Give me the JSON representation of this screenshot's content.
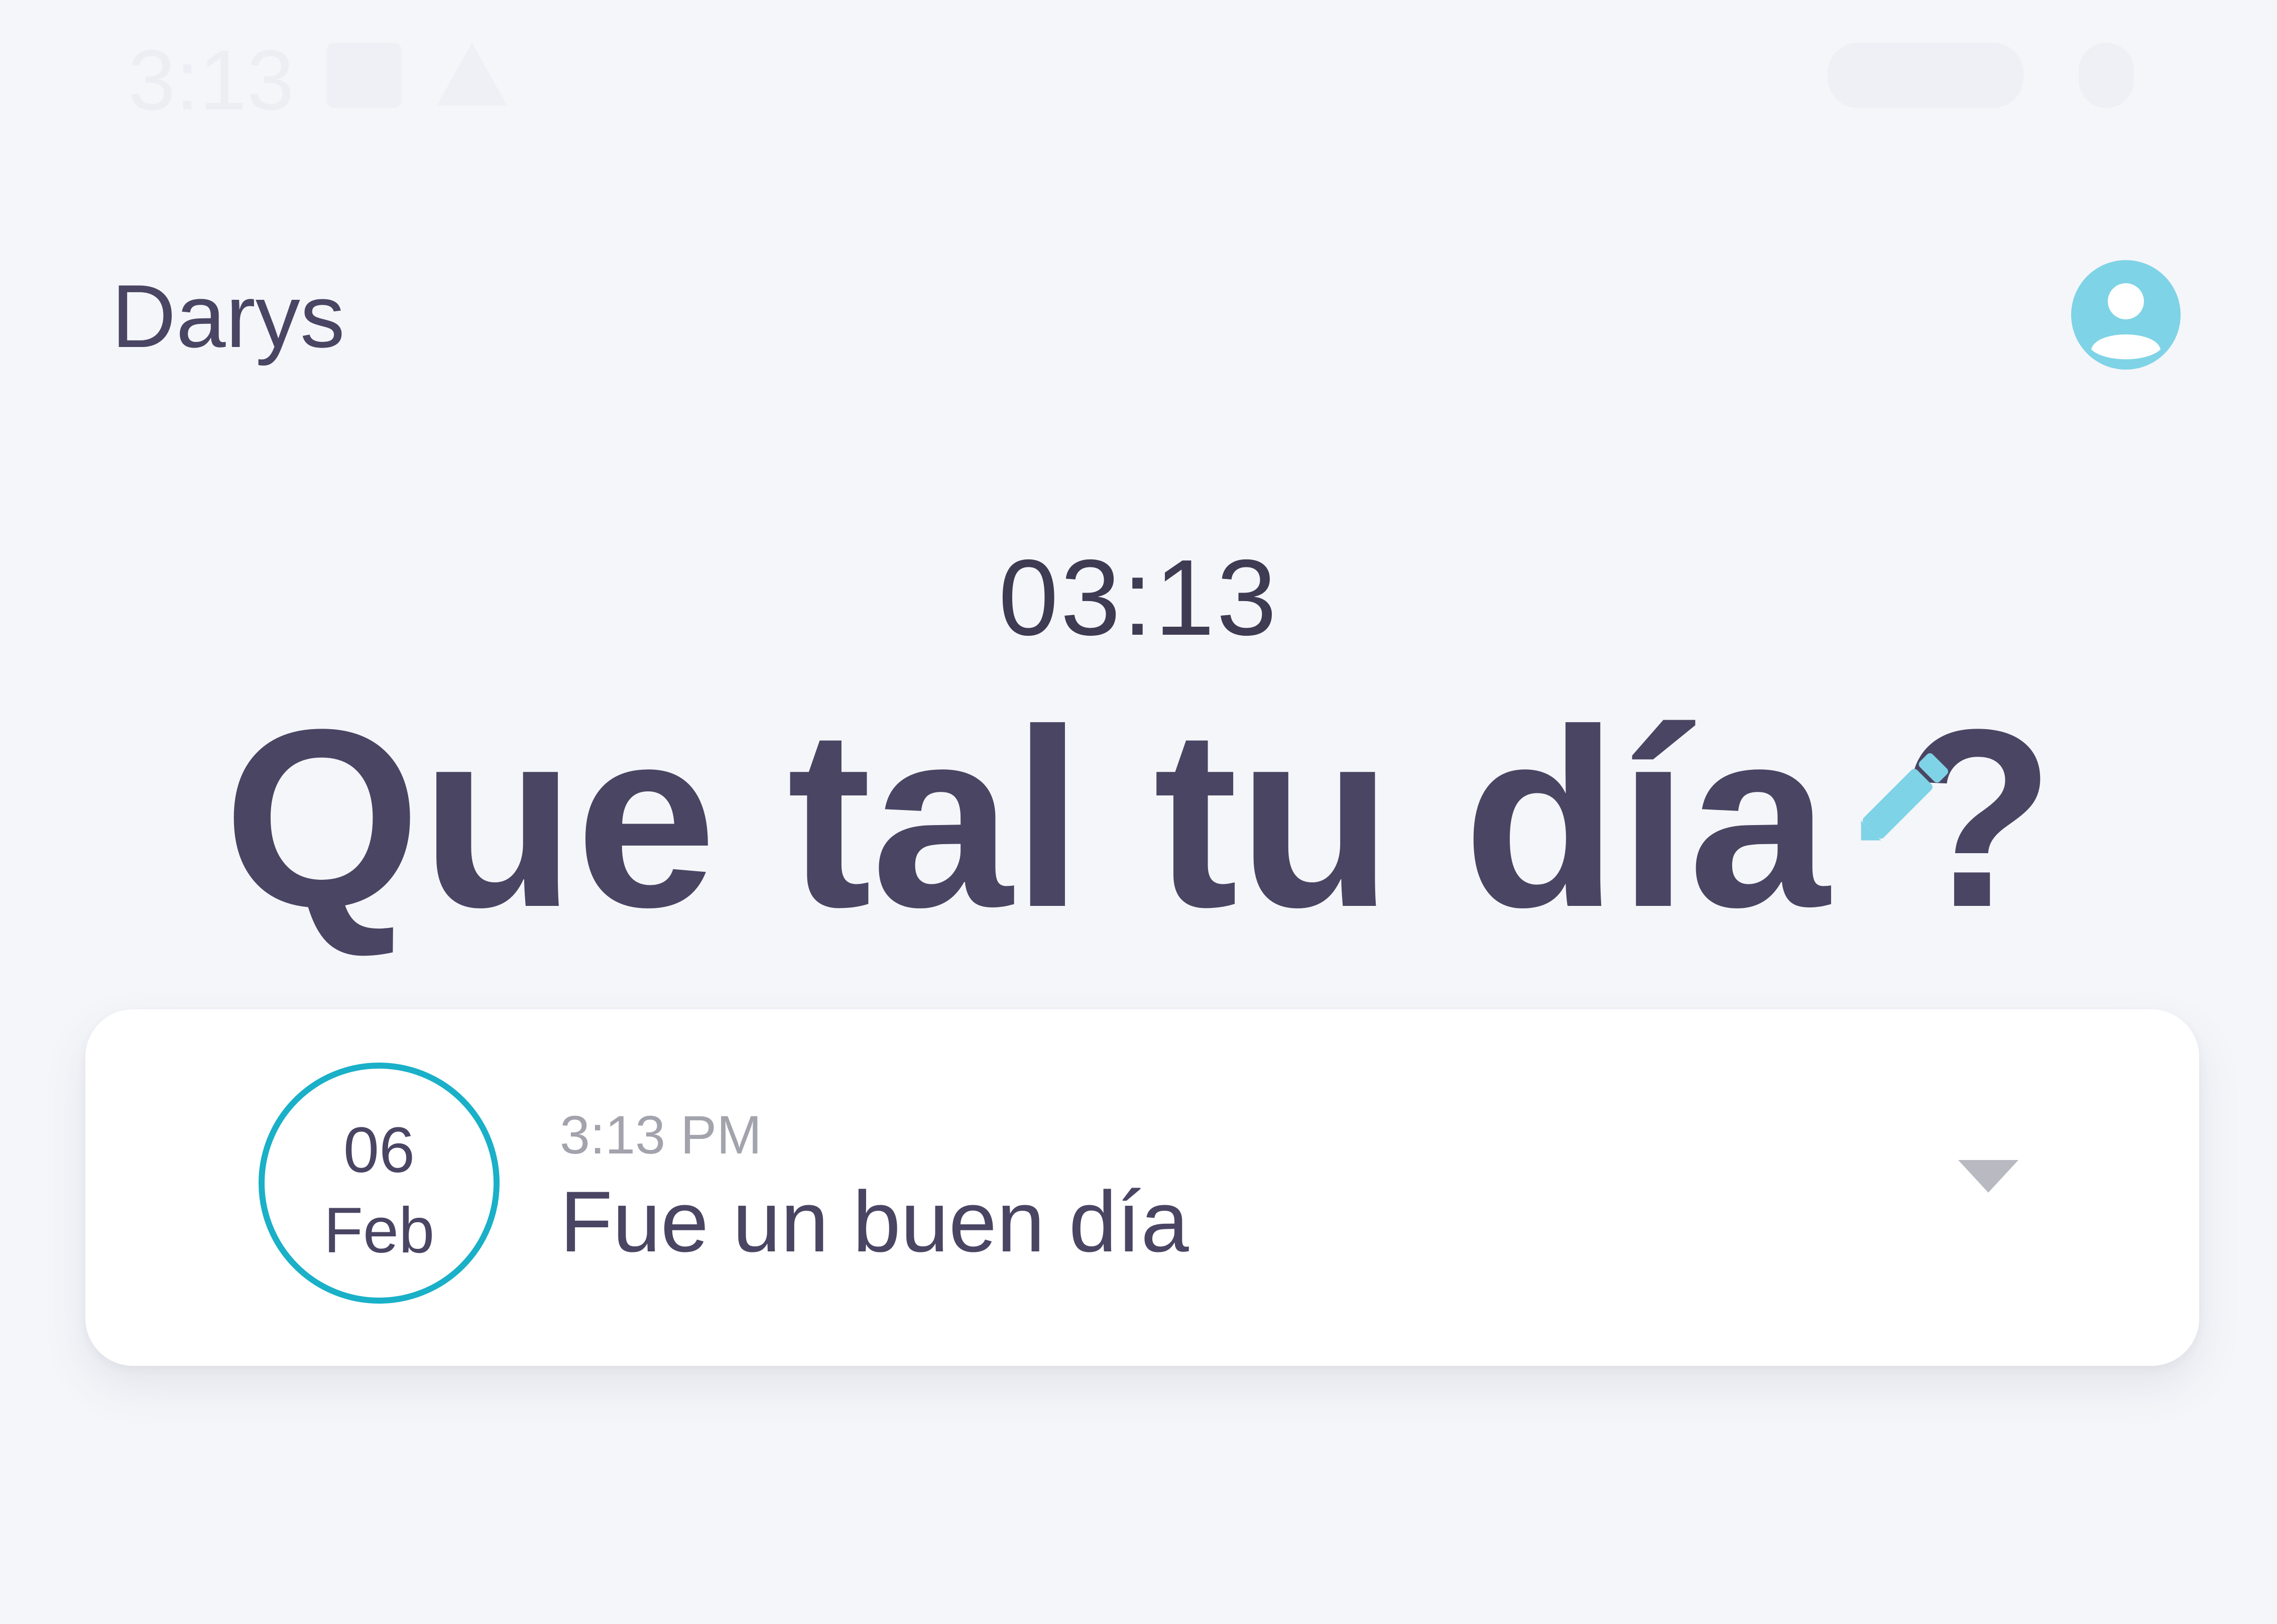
{
  "status_bar": {
    "time": "3:13",
    "icons": [
      "calendar-icon",
      "warning-icon",
      "wifi-icon",
      "battery-icon"
    ]
  },
  "header": {
    "user_name": "Darys",
    "profile_icon": "account-circle-icon"
  },
  "main": {
    "clock": "03:13",
    "prompt": "Que tal tu día ?",
    "edit_icon": "pencil-icon"
  },
  "entries": [
    {
      "day": "06",
      "month": "Feb",
      "time": "3:13 PM",
      "text": "Fue un buen día",
      "expand_icon": "chevron-down-icon"
    }
  ],
  "colors": {
    "background": "#f5f6fa",
    "text_primary": "#4a4563",
    "accent_light": "#7fd3e6",
    "accent_dark": "#19b0c8",
    "muted": "#a3a3ad"
  }
}
